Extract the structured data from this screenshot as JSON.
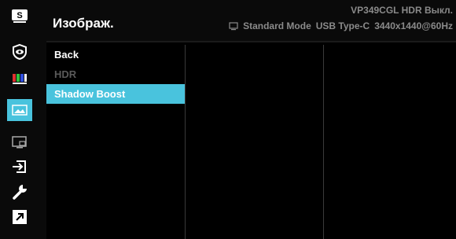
{
  "header": {
    "title": "Изображ.",
    "model_status": "VP349CGL HDR Выкл.",
    "mode": "Standard Mode",
    "input": "USB Type-C",
    "resolution": "3440x1440@60Hz"
  },
  "sidebar": {
    "items": [
      {
        "icon": "splendid-s-icon"
      },
      {
        "icon": "eye-care-icon"
      },
      {
        "icon": "color-bars-icon"
      },
      {
        "icon": "image-icon",
        "selected": true
      },
      {
        "icon": "pip-icon"
      },
      {
        "icon": "input-select-icon"
      },
      {
        "icon": "system-setup-icon"
      },
      {
        "icon": "shortcut-icon"
      }
    ]
  },
  "menu": {
    "items": [
      {
        "label": "Back",
        "state": "normal"
      },
      {
        "label": "HDR",
        "state": "disabled"
      },
      {
        "label": "Shadow Boost",
        "state": "selected"
      }
    ]
  },
  "colors": {
    "accent": "#49c3dd",
    "text": "#ffffff",
    "muted": "#8a8a8a",
    "disabled": "#5a5a5a"
  }
}
